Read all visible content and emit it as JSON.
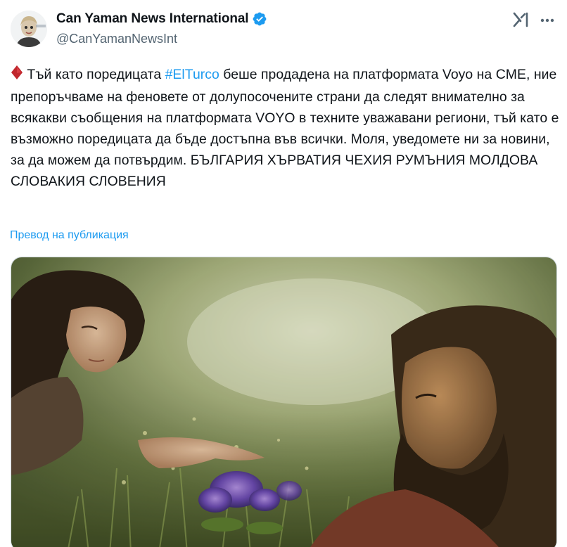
{
  "author": {
    "display_name": "Can Yaman News International",
    "handle": "@CanYamanNewsInt",
    "verified": true,
    "avatar_icon": "avatar-photo",
    "verified_color": "#1d9bf0"
  },
  "header_actions": {
    "grok_icon": "grok-icon",
    "more_icon": "more-icon"
  },
  "post": {
    "emoji": "♦️",
    "text_before_hashtag": " Тъй като поредицата ",
    "hashtag": "#ElTurco",
    "text_after_hashtag": " беше продадена на платформата Voyo на CME, ние препоръчваме на феновете от долупосочените страни да следят внимателно за всякакви съобщения на платформата VOYO в техните уважавани региони, тъй като е възможно поредицата да бъде достъпна във всички. Моля, уведомете ни за новини, за да можем да потвърдим. БЪЛГАРИЯ ХЪРВАТИЯ ЧЕХИЯ РУМЪНИЯ МОЛДОВА СЛОВАКИЯ СЛОВЕНИЯ",
    "translate_label": "Превод на публикация",
    "link_color": "#1d9bf0"
  },
  "media": {
    "kind": "photo"
  }
}
